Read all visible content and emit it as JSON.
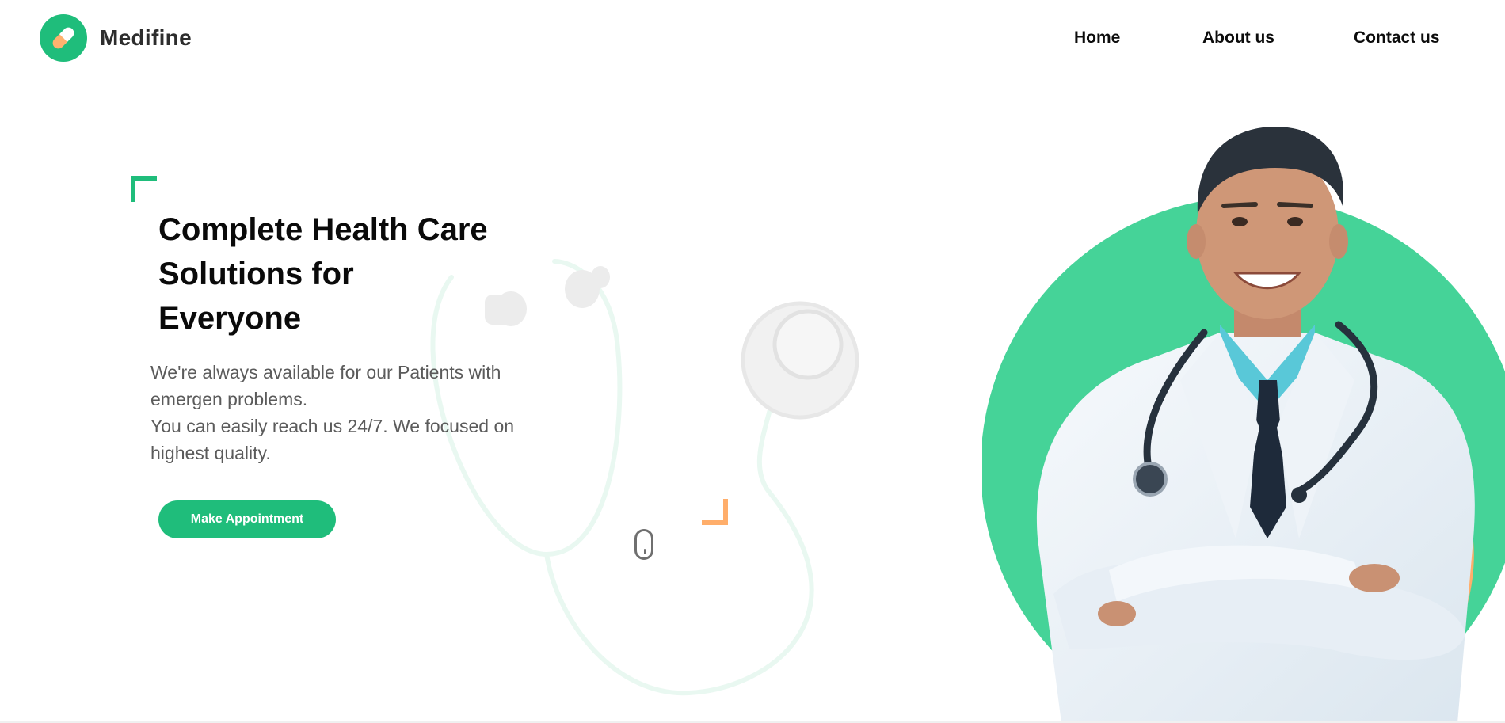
{
  "brand": {
    "name": "Medifine",
    "logo_icon": "pill-icon",
    "accent_color": "#1fbd7b",
    "secondary_color": "#ffae6b"
  },
  "nav": {
    "items": [
      {
        "label": "Home"
      },
      {
        "label": "About us"
      },
      {
        "label": "Contact us"
      }
    ]
  },
  "hero": {
    "title": "Complete Health Care Solutions for Everyone",
    "description_lines": [
      "We're always available for our Patients with emergen problems.",
      "You can easily reach us 24/7. We focused on highest quality."
    ],
    "cta_label": "Make Appointment"
  },
  "decor": {
    "background_icon": "stethoscope-icon",
    "scroll_icon": "mouse-scroll-icon",
    "hero_image": "doctor-portrait"
  }
}
